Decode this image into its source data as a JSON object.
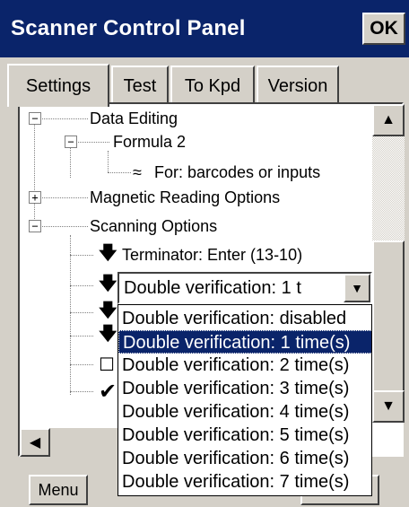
{
  "window": {
    "title": "Scanner Control Panel",
    "ok_label": "OK"
  },
  "tabs": [
    {
      "label": "Settings",
      "active": true
    },
    {
      "label": "Test",
      "active": false
    },
    {
      "label": "To Kpd",
      "active": false
    },
    {
      "label": "Version",
      "active": false
    }
  ],
  "tree": {
    "data_editing": "Data Editing",
    "formula2": "Formula 2",
    "for_rule": "For: barcodes or inputs",
    "magnetic": "Magnetic Reading Options",
    "scanning": "Scanning Options",
    "terminator": "Terminator: Enter (13-10)"
  },
  "combo": {
    "value": "Double verification: 1 t"
  },
  "dropdown": {
    "options": [
      "Double verification: disabled",
      "Double verification: 1 time(s)",
      "Double verification: 2 time(s)",
      "Double verification: 3 time(s)",
      "Double verification: 4 time(s)",
      "Double verification: 5 time(s)",
      "Double verification: 6 time(s)",
      "Double verification: 7 time(s)"
    ],
    "selected_index": 1
  },
  "footer": {
    "menu_label": "Menu"
  },
  "icons": {
    "expand_minus": "−",
    "expand_plus": "+",
    "approx": "≈",
    "down_arrow": "🡇",
    "check": "✔",
    "checkbox": "☐",
    "scroll_up": "▲",
    "scroll_down": "▼",
    "scroll_left": "◀"
  }
}
